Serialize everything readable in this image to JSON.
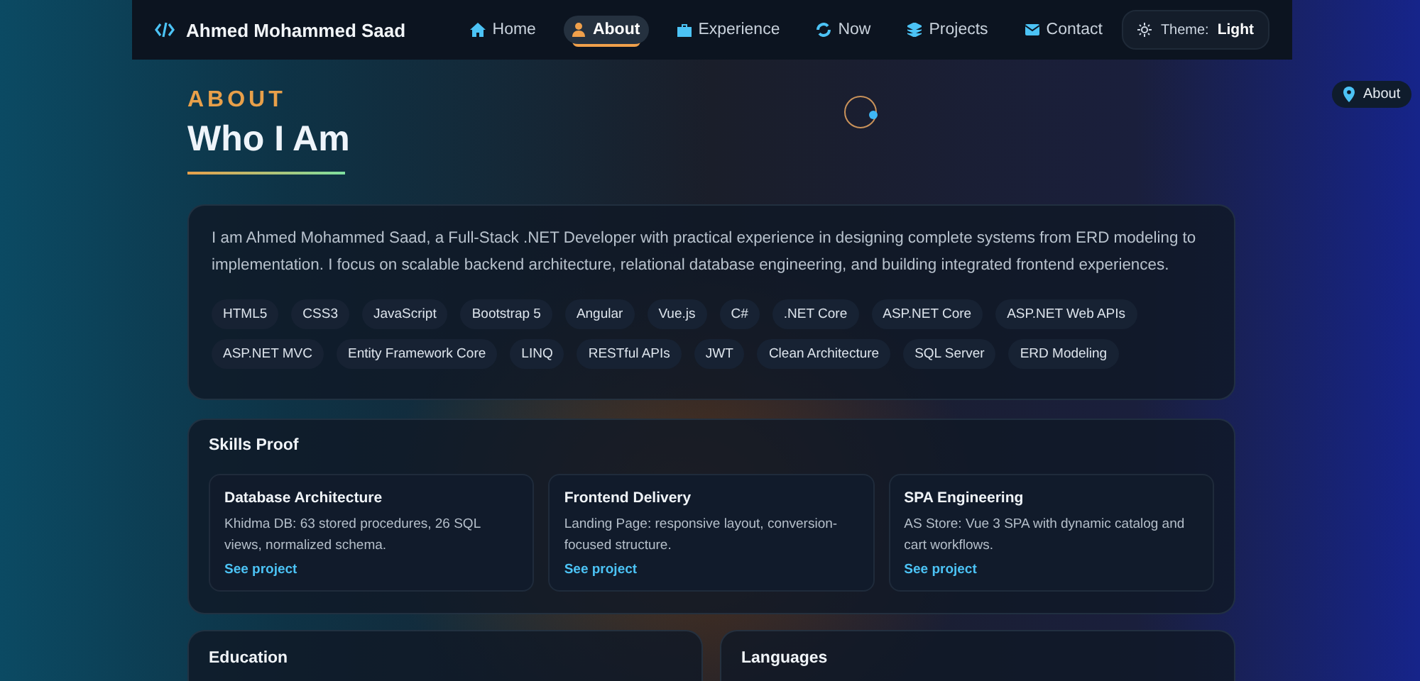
{
  "brand": {
    "name": "Ahmed Mohammed Saad"
  },
  "nav": [
    {
      "label": "Home",
      "kind": "home",
      "selected": false
    },
    {
      "label": "About",
      "kind": "person",
      "selected": true
    },
    {
      "label": "Experience",
      "kind": "briefcase",
      "selected": false
    },
    {
      "label": "Now",
      "kind": "spin",
      "selected": false
    },
    {
      "label": "Projects",
      "kind": "layers",
      "selected": false
    },
    {
      "label": "Contact",
      "kind": "mail",
      "selected": false
    }
  ],
  "theme": {
    "label": "Theme:",
    "value": "Light"
  },
  "section_pill": {
    "label": "About"
  },
  "about": {
    "eyebrow": "ABOUT",
    "title": "Who I Am",
    "text": "I am Ahmed Mohammed Saad, a Full-Stack .NET Developer with practical experience in designing complete systems from ERD modeling to implementation. I focus on scalable backend architecture, relational database engineering, and building integrated frontend experiences.",
    "tags": [
      "HTML5",
      "CSS3",
      "JavaScript",
      "Bootstrap 5",
      "Angular",
      "Vue.js",
      "C#",
      ".NET Core",
      "ASP.NET Core",
      "ASP.NET Web APIs",
      "ASP.NET MVC",
      "Entity Framework Core",
      "LINQ",
      "RESTful APIs",
      "JWT",
      "Clean Architecture",
      "SQL Server",
      "ERD Modeling"
    ]
  },
  "skills_proof": {
    "title": "Skills Proof",
    "cards": [
      {
        "title": "Database Architecture",
        "text": "Khidma DB: 63 stored procedures, 26 SQL views, normalized schema.",
        "link": "See project"
      },
      {
        "title": "Frontend Delivery",
        "text": "Landing Page: responsive layout, conversion-focused structure.",
        "link": "See project"
      },
      {
        "title": "SPA Engineering",
        "text": "AS Store: Vue 3 SPA with dynamic catalog and cart workflows.",
        "link": "See project"
      }
    ]
  },
  "panels": [
    {
      "title": "Education"
    },
    {
      "title": "Languages"
    }
  ]
}
